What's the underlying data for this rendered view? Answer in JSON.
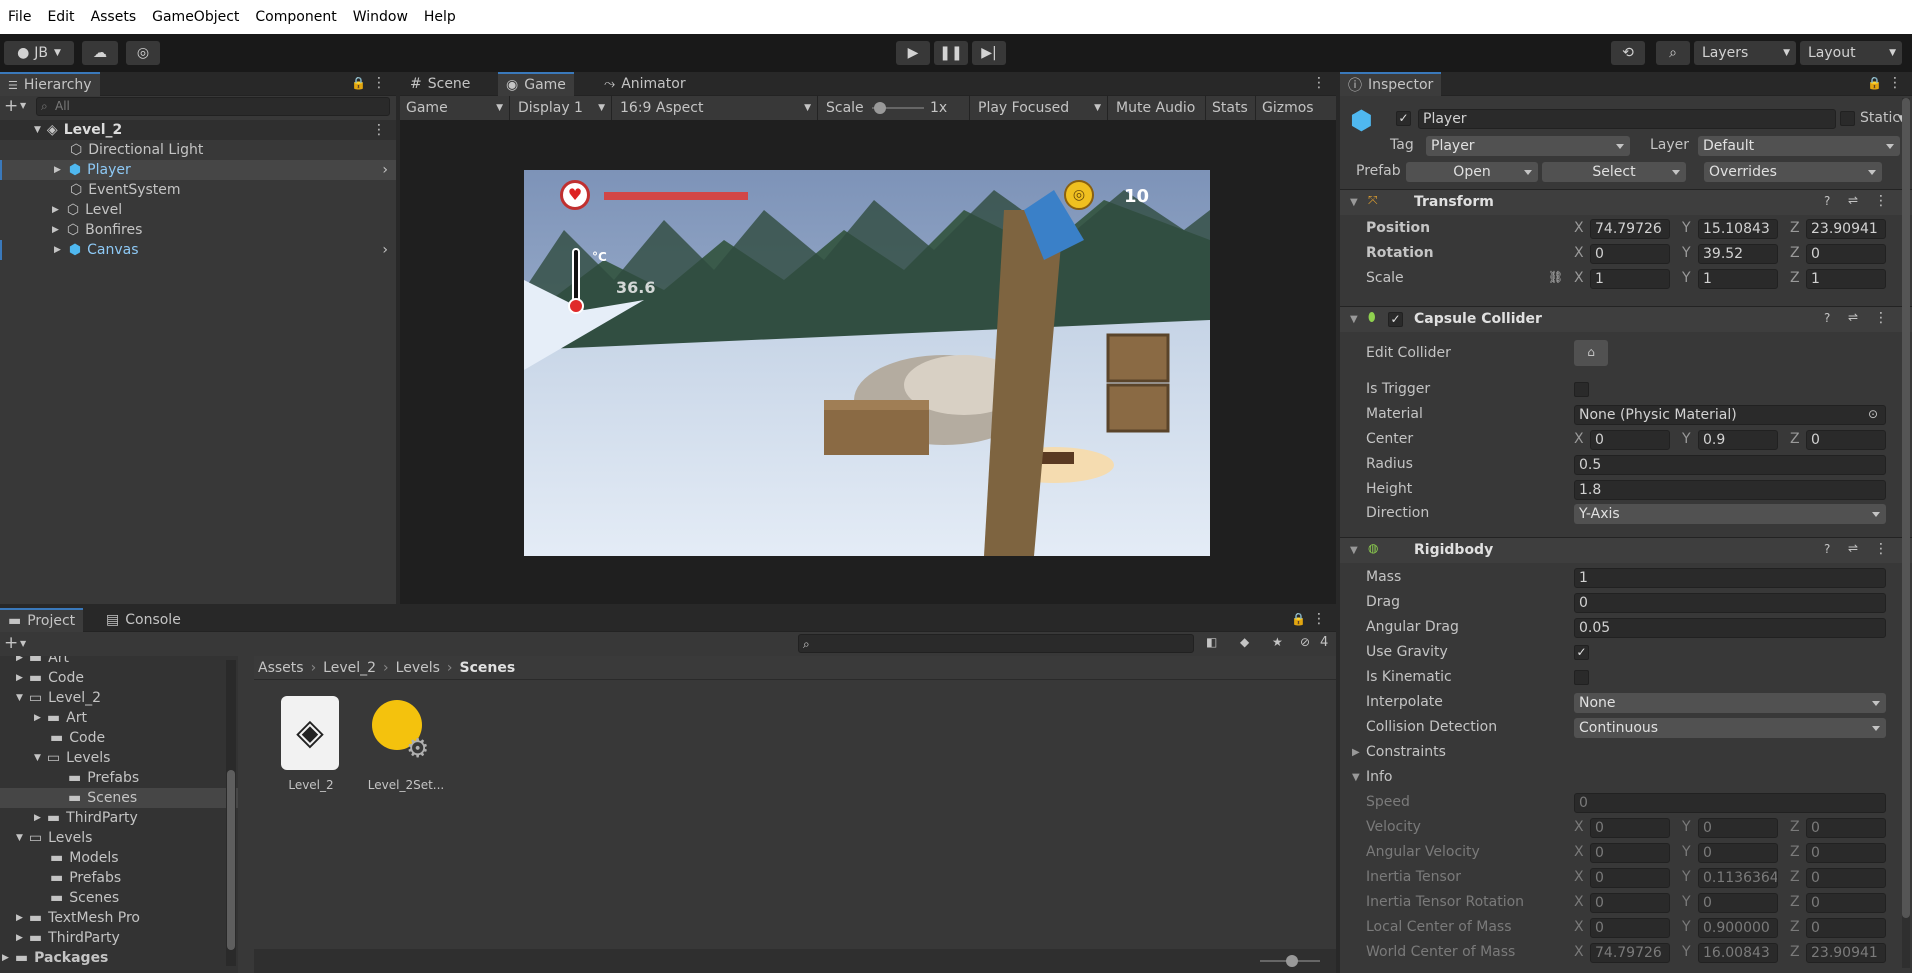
{
  "menu": [
    "File",
    "Edit",
    "Assets",
    "GameObject",
    "Component",
    "Window",
    "Help"
  ],
  "toolbar": {
    "account": "JB",
    "history_icon": "history-icon",
    "layers": "Layers",
    "layout": "Layout"
  },
  "hierarchy": {
    "tab": "Hierarchy",
    "search_placeholder": "All",
    "scene": "Level_2",
    "items": [
      {
        "label": "Directional Light"
      },
      {
        "label": "Player"
      },
      {
        "label": "EventSystem"
      },
      {
        "label": "Level"
      },
      {
        "label": "Bonfires"
      },
      {
        "label": "Canvas"
      }
    ]
  },
  "center_tabs": {
    "scene": "Scene",
    "game": "Game",
    "animator": "Animator"
  },
  "game_bar": {
    "mode": "Game",
    "display": "Display 1",
    "aspect": "16:9 Aspect",
    "scale_label": "Scale",
    "scale_value": "1x",
    "play_focused": "Play Focused",
    "mute": "Mute Audio",
    "stats": "Stats",
    "gizmos": "Gizmos"
  },
  "game_view": {
    "temperature": "36.6",
    "temp_unit": "°C",
    "coins": "10",
    "health_fraction": 1.0
  },
  "project": {
    "tabs": {
      "project": "Project",
      "console": "Console"
    },
    "hidden_count": "4",
    "tree": [
      {
        "label": "Art"
      },
      {
        "label": "Code"
      },
      {
        "label": "Level_2"
      },
      {
        "label": "Art"
      },
      {
        "label": "Code"
      },
      {
        "label": "Levels"
      },
      {
        "label": "Prefabs"
      },
      {
        "label": "Scenes"
      },
      {
        "label": "ThirdParty"
      },
      {
        "label": "Levels"
      },
      {
        "label": "Models"
      },
      {
        "label": "Prefabs"
      },
      {
        "label": "Scenes"
      },
      {
        "label": "TextMesh Pro"
      },
      {
        "label": "ThirdParty"
      },
      {
        "label": "Packages"
      }
    ],
    "breadcrumb": [
      "Assets",
      "Level_2",
      "Levels",
      "Scenes"
    ],
    "assets": [
      {
        "label": "Level_2"
      },
      {
        "label": "Level_2Set..."
      }
    ]
  },
  "inspector": {
    "tab": "Inspector",
    "name": "Player",
    "static": "Static",
    "tag_label": "Tag",
    "tag": "Player",
    "layer_label": "Layer",
    "layer": "Default",
    "prefab_label": "Prefab",
    "open": "Open",
    "select": "Select",
    "overrides": "Overrides",
    "transform": {
      "title": "Transform",
      "position_label": "Position",
      "position": [
        "74.79726",
        "15.10843",
        "23.90941"
      ],
      "rotation_label": "Rotation",
      "rotation": [
        "0",
        "39.52",
        "0"
      ],
      "scale_label": "Scale",
      "scale": [
        "1",
        "1",
        "1"
      ]
    },
    "capsule": {
      "title": "Capsule Collider",
      "edit_label": "Edit Collider",
      "trigger_label": "Is Trigger",
      "material_label": "Material",
      "material": "None (Physic Material)",
      "center_label": "Center",
      "center": [
        "0",
        "0.9",
        "0"
      ],
      "radius_label": "Radius",
      "radius": "0.5",
      "height_label": "Height",
      "height": "1.8",
      "direction_label": "Direction",
      "direction": "Y-Axis"
    },
    "rigidbody": {
      "title": "Rigidbody",
      "mass_label": "Mass",
      "mass": "1",
      "drag_label": "Drag",
      "drag": "0",
      "angdrag_label": "Angular Drag",
      "angdrag": "0.05",
      "gravity_label": "Use Gravity",
      "kinematic_label": "Is Kinematic",
      "interp_label": "Interpolate",
      "interp": "None",
      "collision_label": "Collision Detection",
      "collision": "Continuous",
      "constraints_label": "Constraints",
      "info_label": "Info",
      "speed_label": "Speed",
      "speed": "0",
      "velocity_label": "Velocity",
      "velocity": [
        "0",
        "0",
        "0"
      ],
      "angvel_label": "Angular Velocity",
      "angvel": [
        "0",
        "0",
        "0"
      ],
      "inertia_label": "Inertia Tensor",
      "inertia": [
        "0",
        "0.1136364",
        "0"
      ],
      "inertiarot_label": "Inertia Tensor Rotation",
      "inertiarot": [
        "0",
        "0",
        "0"
      ],
      "localcom_label": "Local Center of Mass",
      "localcom": [
        "0",
        "0.900000",
        "0"
      ],
      "worldcom_label": "World Center of Mass",
      "worldcom": [
        "74.79726",
        "16.00843",
        "23.90941"
      ]
    }
  },
  "axes": [
    "X",
    "Y",
    "Z"
  ]
}
